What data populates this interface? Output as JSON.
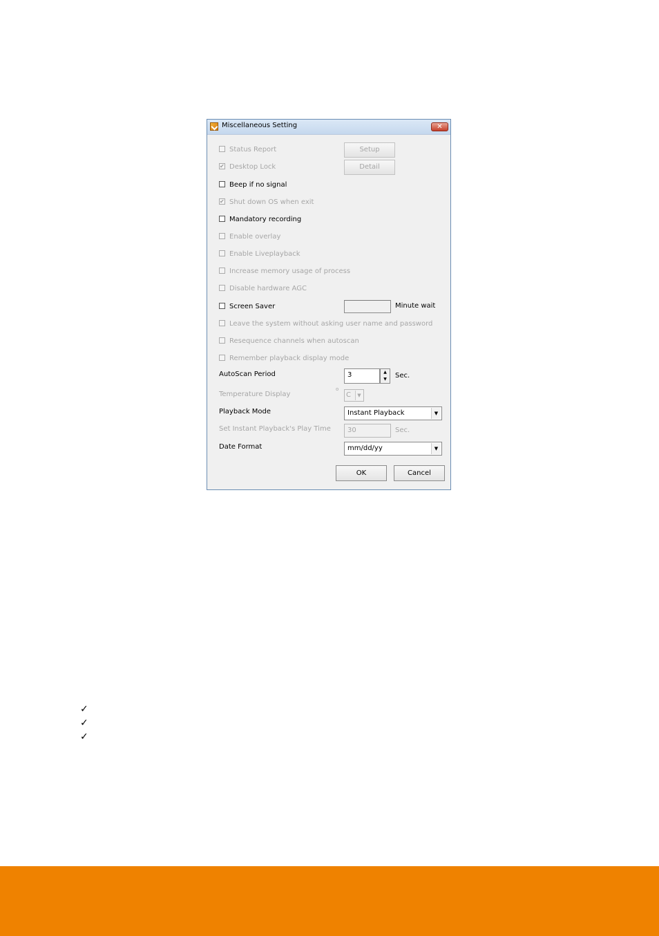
{
  "dialog": {
    "title": "Miscellaneous Setting",
    "close_glyph": "✕",
    "options": [
      {
        "label": "Status Report",
        "checked": false,
        "enabled": false
      },
      {
        "label": "Desktop Lock",
        "checked": true,
        "enabled": false
      },
      {
        "label": "Beep if no signal",
        "checked": false,
        "enabled": true
      },
      {
        "label": "Shut down OS when exit",
        "checked": true,
        "enabled": false
      },
      {
        "label": "Mandatory recording",
        "checked": false,
        "enabled": true
      },
      {
        "label": "Enable overlay",
        "checked": false,
        "enabled": false
      },
      {
        "label": "Enable Liveplayback",
        "checked": false,
        "enabled": false
      },
      {
        "label": "Increase memory usage of process",
        "checked": false,
        "enabled": false
      },
      {
        "label": "Disable hardware AGC",
        "checked": false,
        "enabled": false
      },
      {
        "label": "Screen Saver",
        "checked": false,
        "enabled": true
      },
      {
        "label": "Leave the system without asking user name and password",
        "checked": false,
        "enabled": false
      },
      {
        "label": "Resequence channels when autoscan",
        "checked": false,
        "enabled": false
      },
      {
        "label": "Remember playback display mode",
        "checked": false,
        "enabled": false
      }
    ],
    "setup_button": "Setup",
    "detail_button": "Detail",
    "screen_saver_value": "",
    "minute_wait_label": "Minute wait",
    "autoscan": {
      "label": "AutoScan Period",
      "value": "3",
      "unit": "Sec."
    },
    "temperature": {
      "label": "Temperature Display",
      "degree": "o",
      "value": "C"
    },
    "playback_mode": {
      "label": "Playback Mode",
      "value": "Instant Playback"
    },
    "instant_play_time": {
      "label": "Set Instant Playback's Play Time",
      "value": "30",
      "unit": "Sec."
    },
    "date_format": {
      "label": "Date Format",
      "value": "mm/dd/yy"
    },
    "ok_button": "OK",
    "cancel_button": "Cancel"
  },
  "page": {
    "checkmarks": [
      "✓",
      "✓",
      "✓"
    ],
    "footer_color": "#ef8200"
  }
}
